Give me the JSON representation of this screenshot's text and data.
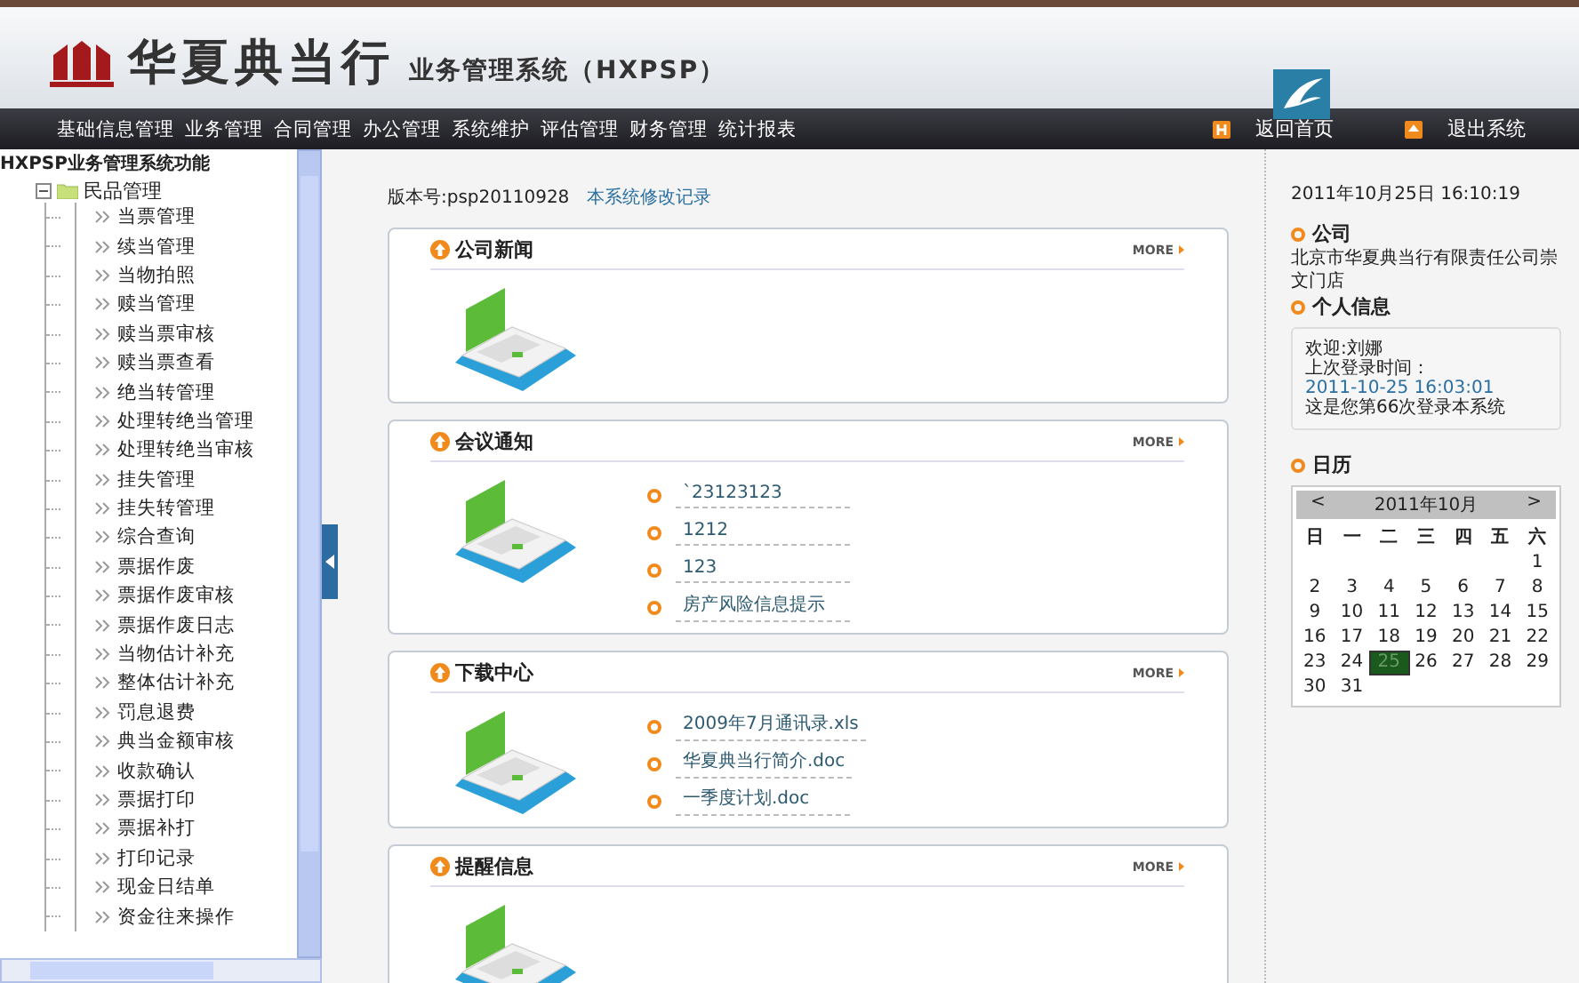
{
  "header": {
    "brand": "华夏典当行",
    "subtitle": "业务管理系统（HXPSP）"
  },
  "nav": {
    "items": [
      "基础信息管理",
      "业务管理",
      "合同管理",
      "办公管理",
      "系统维护",
      "评估管理",
      "财务管理",
      "统计报表"
    ],
    "actions": [
      {
        "kind": "home",
        "label": "返回首页"
      },
      {
        "kind": "exit",
        "label": "退出系统"
      }
    ]
  },
  "sidebar": {
    "tree": {
      "label": "HXPSP业务管理系统功能",
      "children": [
        {
          "label": "民品管理",
          "expanded": true,
          "children": [
            {
              "label": "当票管理"
            },
            {
              "label": "续当管理"
            },
            {
              "label": "当物拍照"
            },
            {
              "label": "赎当管理"
            },
            {
              "label": "赎当票审核"
            },
            {
              "label": "赎当票查看"
            },
            {
              "label": "绝当转管理"
            },
            {
              "label": "处理转绝当管理"
            },
            {
              "label": "处理转绝当审核"
            },
            {
              "label": "挂失管理"
            },
            {
              "label": "挂失转管理"
            },
            {
              "label": "综合查询"
            },
            {
              "label": "票据作废"
            },
            {
              "label": "票据作废审核"
            },
            {
              "label": "票据作废日志"
            },
            {
              "label": "当物估计补充"
            },
            {
              "label": "整体估计补充"
            },
            {
              "label": "罚息退费"
            },
            {
              "label": "典当金额审核"
            },
            {
              "label": "收款确认"
            },
            {
              "label": "票据打印"
            },
            {
              "label": "票据补打"
            },
            {
              "label": "打印记录"
            },
            {
              "label": "现金日结单"
            },
            {
              "label": "资金往来操作"
            }
          ]
        }
      ]
    }
  },
  "main": {
    "version": "版本号:psp20110928",
    "changelog_link": "本系统修改记录",
    "cards": [
      {
        "title": "公司新闻",
        "more": "MORE"
      },
      {
        "title": "会议通知",
        "more": "MORE",
        "items": [
          "`23123123",
          "1212",
          "123",
          "房产风险信息提示"
        ]
      },
      {
        "title": "下载中心",
        "more": "MORE",
        "items": [
          "2009年7月通讯录.xls",
          "华夏典当行简介.doc",
          "一季度计划.doc"
        ]
      },
      {
        "title": "提醒信息",
        "more": "MORE"
      }
    ]
  },
  "right_panel": {
    "datetime": "2011年10月25日 16:10:19",
    "company_title": "公司",
    "company": "北京市华夏典当行有限责任公司崇文门店",
    "personal_title": "个人信息",
    "personal_lines": [
      {
        "kind": "text",
        "text": "欢迎:刘娜"
      },
      {
        "kind": "text",
        "text": "上次登录时间："
      },
      {
        "kind": "link",
        "text": "2011-10-25 16:03:01"
      },
      {
        "kind": "text",
        "text": "这是您第66次登录本系统"
      }
    ],
    "calendar_title": "日历",
    "calendar": {
      "prev": "<",
      "month": "2011年10月",
      "next": ">",
      "weekdays": [
        "日",
        "一",
        "二",
        "三",
        "四",
        "五",
        "六"
      ],
      "weeks": [
        [
          {
            "day": "1",
            "selected": false
          }
        ],
        [
          {
            "day": "2",
            "selected": false
          },
          {
            "day": "3",
            "selected": false
          },
          {
            "day": "4",
            "selected": false
          },
          {
            "day": "5",
            "selected": false
          },
          {
            "day": "6",
            "selected": false
          },
          {
            "day": "7",
            "selected": false
          },
          {
            "day": "8",
            "selected": false
          }
        ],
        [
          {
            "day": "9",
            "selected": false
          },
          {
            "day": "10",
            "selected": false
          },
          {
            "day": "11",
            "selected": false
          },
          {
            "day": "12",
            "selected": false
          },
          {
            "day": "13",
            "selected": false
          },
          {
            "day": "14",
            "selected": false
          },
          {
            "day": "15",
            "selected": false
          }
        ],
        [
          {
            "day": "16",
            "selected": false
          },
          {
            "day": "17",
            "selected": false
          },
          {
            "day": "18",
            "selected": false
          },
          {
            "day": "19",
            "selected": false
          },
          {
            "day": "20",
            "selected": false
          },
          {
            "day": "21",
            "selected": false
          },
          {
            "day": "22",
            "selected": false
          }
        ],
        [
          {
            "day": "23",
            "selected": false
          },
          {
            "day": "24",
            "selected": false
          },
          {
            "day": "25",
            "selected": true
          },
          {
            "day": "26",
            "selected": false
          },
          {
            "day": "27",
            "selected": false
          },
          {
            "day": "28",
            "selected": false
          },
          {
            "day": "29",
            "selected": false
          }
        ],
        [
          {
            "day": "30",
            "selected": false
          },
          {
            "day": "31",
            "selected": false
          }
        ]
      ]
    }
  }
}
